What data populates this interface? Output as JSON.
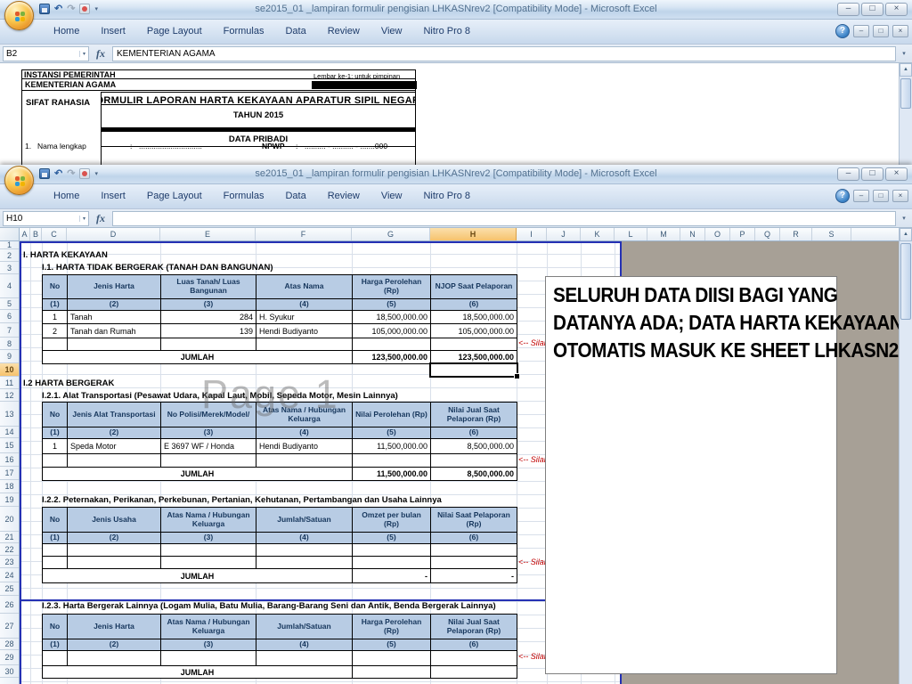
{
  "chrome": {
    "title": "se2015_01 _lampiran formulir pengisian LHKASNrev2   [Compatibility Mode] - Microsoft Excel",
    "tabs": [
      "Home",
      "Insert",
      "Page Layout",
      "Formulas",
      "Data",
      "Review",
      "View",
      "Nitro Pro 8"
    ],
    "fx_label": "fx",
    "icons": {
      "minimize": "–",
      "maximize": "□",
      "close": "×",
      "help": "?",
      "dropdown": "▾",
      "undo": "↶",
      "redo": "↷",
      "scroll_up": "▲"
    }
  },
  "top_window": {
    "name_box": "B2",
    "formula": "KEMENTERIAN AGAMA",
    "form": {
      "instansi_label": "INSTANSI PEMERINTAH",
      "instansi_value": "KEMENTERIAN AGAMA",
      "lembar_note": "Lembar ke-1: untuk pimpinan",
      "sifat_rahasia": "SIFAT RAHASIA",
      "form_title": "FORMULIR LAPORAN HARTA KEKAYAAN APARATUR SIPIL NEGARA",
      "tahun": "TAHUN 2015",
      "section_title": "DATA PRIBADI",
      "field_no": "1.",
      "field_label": "Nama lengkap",
      "field_colon": ":",
      "field_dots": "..............................",
      "npwp_label": "NPWP",
      "npwp_colon": ":",
      "npwp_value": ".......... - .......... - .......000"
    }
  },
  "bottom_window": {
    "name_box": "H10",
    "formula": "",
    "columns": [
      "A",
      "B",
      "C",
      "D",
      "E",
      "F",
      "G",
      "H",
      "I",
      "J",
      "K",
      "L",
      "M",
      "N",
      "O",
      "P",
      "Q",
      "R",
      "S"
    ],
    "rows": [
      "1",
      "2",
      "3",
      "4",
      "5",
      "6",
      "7",
      "8",
      "9",
      "10",
      "11",
      "12",
      "13",
      "14",
      "15",
      "16",
      "17",
      "18",
      "19",
      "20",
      "21",
      "22",
      "23",
      "24",
      "25",
      "26",
      "27",
      "28",
      "29",
      "30"
    ]
  },
  "sheet": {
    "watermark": "Page 1",
    "annotation": "<-- Silah",
    "sec1": "I. HARTA KEKAYAAN",
    "t1_title": "I.1.  HARTA TIDAK BERGERAK (TANAH DAN BANGUNAN)",
    "sec12": "I.2  HARTA BERGERAK",
    "t2_title": "I.2.1.  Alat Transportasi (Pesawat Udara, Kapal Laut, Mobil, Sepeda Motor, Mesin Lainnya)",
    "t3_title": "I.2.2.  Peternakan, Perikanan, Perkebunan, Pertanian, Kehutanan, Pertambangan dan Usaha Lainnya",
    "t4_title": "I.2.3.  Harta Bergerak Lainnya (Logam Mulia, Batu Mulia, Barang-Barang Seni dan Antik, Benda Bergerak Lainnya)",
    "t1": {
      "h": [
        "No",
        "Jenis Harta",
        "Luas Tanah/ Luas Bangunan",
        "Atas Nama",
        "Harga Perolehan (Rp)",
        "NJOP Saat Pelaporan"
      ],
      "n": [
        "(1)",
        "(2)",
        "(3)",
        "(4)",
        "(5)",
        "(6)"
      ],
      "r1": [
        "1",
        "Tanah",
        "284",
        "H. Syukur",
        "18,500,000.00",
        "18,500,000.00"
      ],
      "r2": [
        "2",
        "Tanah dan Rumah",
        "139",
        "Hendi Budiyanto",
        "105,000,000.00",
        "105,000,000.00"
      ],
      "jumlah": "JUMLAH",
      "tot5": "123,500,000.00",
      "tot6": "123,500,000.00"
    },
    "t2": {
      "h": [
        "No",
        "Jenis Alat Transportasi",
        "No Polisi/Merek/Model/",
        "Atas Nama / Hubungan Keluarga",
        "Nilai Perolehan (Rp)",
        "Nilai Jual Saat Pelaporan (Rp)"
      ],
      "n": [
        "(1)",
        "(2)",
        "(3)",
        "(4)",
        "(5)",
        "(6)"
      ],
      "r1": [
        "1",
        "Speda Motor",
        "E 3697 WF / Honda",
        "Hendi Budiyanto",
        "11,500,000.00",
        "8,500,000.00"
      ],
      "jumlah": "JUMLAH",
      "tot5": "11,500,000.00",
      "tot6": "8,500,000.00"
    },
    "t3": {
      "h": [
        "No",
        "Jenis Usaha",
        "Atas Nama / Hubungan Keluarga",
        "Jumlah/Satuan",
        "Omzet per bulan (Rp)",
        "Nilai Saat Pelaporan (Rp)"
      ],
      "n": [
        "(1)",
        "(2)",
        "(3)",
        "(4)",
        "(5)",
        "(6)"
      ],
      "jumlah": "JUMLAH",
      "tot5": "-",
      "tot6": "-"
    },
    "t4": {
      "h": [
        "No",
        "Jenis Harta",
        "Atas Nama / Hubungan Keluarga",
        "Jumlah/Satuan",
        "Harga Perolehan (Rp)",
        "Nilai Jual Saat Pelaporan (Rp)"
      ],
      "n": [
        "(1)",
        "(2)",
        "(3)",
        "(4)",
        "(5)",
        "(6)"
      ],
      "jumlah": "JUMLAH"
    },
    "note_lines": {
      "l1": "SELURUH DATA DIISI BAGI YANG",
      "l2": "DATANYA ADA; DATA HARTA KEKAYAAN",
      "l3": "OTOMATIS MASUK KE SHEET LHKASN2"
    }
  },
  "colors": {
    "table_header_fill": "#b8cce4",
    "page_break_blue": "#2531b4",
    "annotation_red": "#c00000",
    "selected_header_fill": "#f6c26d"
  }
}
